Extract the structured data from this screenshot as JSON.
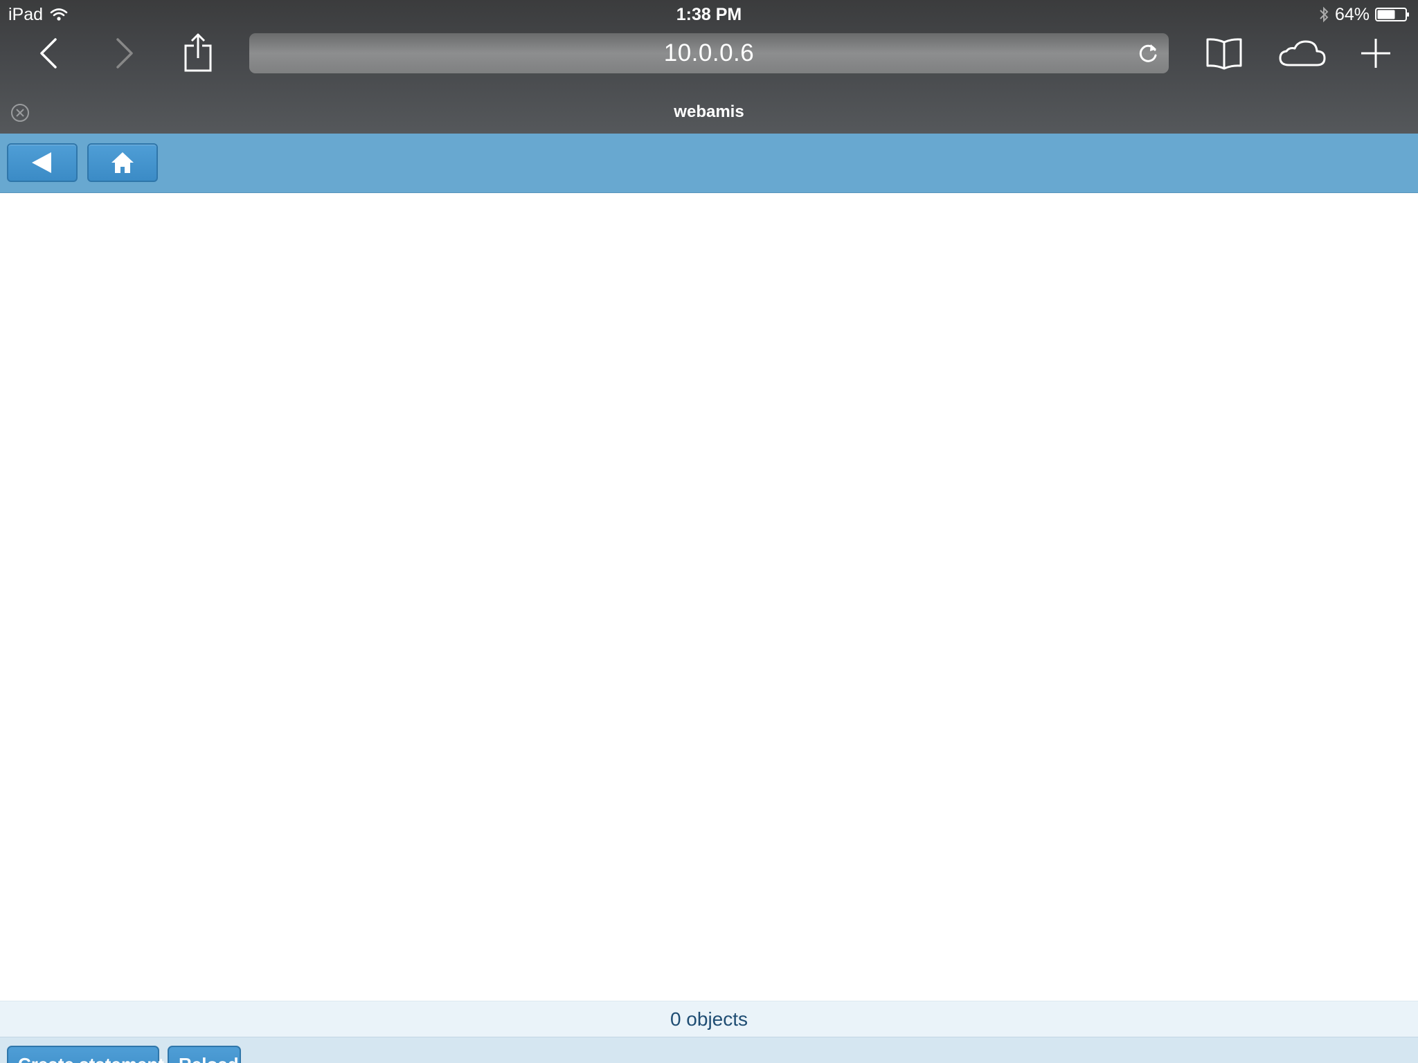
{
  "status_bar": {
    "device": "iPad",
    "time": "1:38 PM",
    "battery": "64%",
    "battery_level": 0.64,
    "icons": [
      "wifi-icon",
      "bluetooth-icon",
      "battery-icon"
    ]
  },
  "browser": {
    "url": "10.0.0.6",
    "tab_title": "webamis",
    "icons": [
      "back-icon",
      "forward-icon",
      "share-icon",
      "reload-icon",
      "bookmarks-icon",
      "cloud-tabs-icon",
      "new-tab-icon",
      "close-tab-icon"
    ]
  },
  "app_header": {
    "icons": [
      "back-arrow-icon",
      "home-icon"
    ]
  },
  "footer": {
    "objects_count": "0 objects"
  },
  "toolbar": {
    "create_statement_label": "Create statement",
    "reload_label": "Reload"
  },
  "colors": {
    "chrome_dark": "#3b3c3d",
    "header_blue": "#68a8d0",
    "button_blue": "#3b8bc6",
    "footer_bg": "#eaf3f9",
    "count_text": "#1f4d73"
  }
}
